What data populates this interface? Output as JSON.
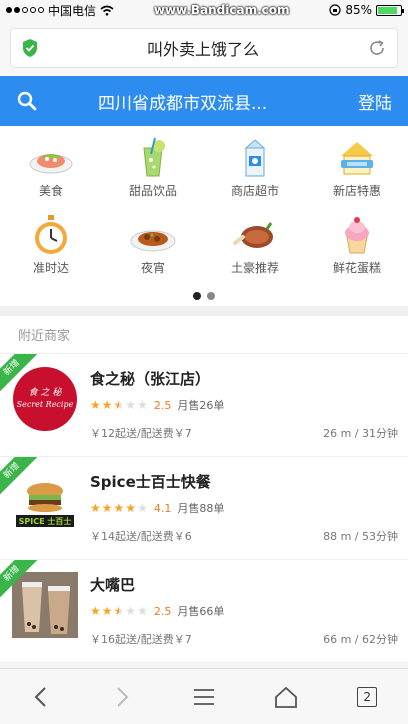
{
  "status_bar": {
    "carrier": "中国电信",
    "watermark": "www.Bandicam.com",
    "battery_percent_label": "85%",
    "battery_level": 0.85
  },
  "browser": {
    "page_title": "叫外卖上饿了么"
  },
  "header": {
    "location": "四川省成都市双流县...",
    "login_label": "登陆"
  },
  "categories": [
    {
      "label": "美食",
      "icon": "food-bowl-icon"
    },
    {
      "label": "甜品饮品",
      "icon": "drink-icon"
    },
    {
      "label": "商店超市",
      "icon": "milk-carton-icon"
    },
    {
      "label": "新店特惠",
      "icon": "new-store-icon"
    },
    {
      "label": "准时达",
      "icon": "stopwatch-icon"
    },
    {
      "label": "夜宵",
      "icon": "night-snack-icon"
    },
    {
      "label": "土豪推荐",
      "icon": "meat-icon"
    },
    {
      "label": "鲜花蛋糕",
      "icon": "cupcake-icon"
    }
  ],
  "pager": {
    "pages": 2,
    "active": 0
  },
  "nearby": {
    "title": "附近商家",
    "shops": [
      {
        "name": "食之秘（张江店）",
        "badge": "新增",
        "rating": 2.5,
        "rating_label": "2.5",
        "sold": "月售26单",
        "fees": "￥12起送/配送费￥7",
        "distance": "26 m / 31分钟",
        "image": "secret-recipe-logo"
      },
      {
        "name": "Spice士百士快餐",
        "badge": "新增",
        "rating": 4.1,
        "rating_label": "4.1",
        "sold": "月售88单",
        "fees": "￥14起送/配送费￥6",
        "distance": "88 m / 53分钟",
        "image": "spice-burger-logo"
      },
      {
        "name": "大嘴巴",
        "badge": "新增",
        "rating": 2.5,
        "rating_label": "2.5",
        "sold": "月售66单",
        "fees": "￥16起送/配送费￥7",
        "distance": "66 m / 62分钟",
        "image": "bubble-tea-photo"
      }
    ]
  },
  "toolbar": {
    "tab_count": "2"
  }
}
